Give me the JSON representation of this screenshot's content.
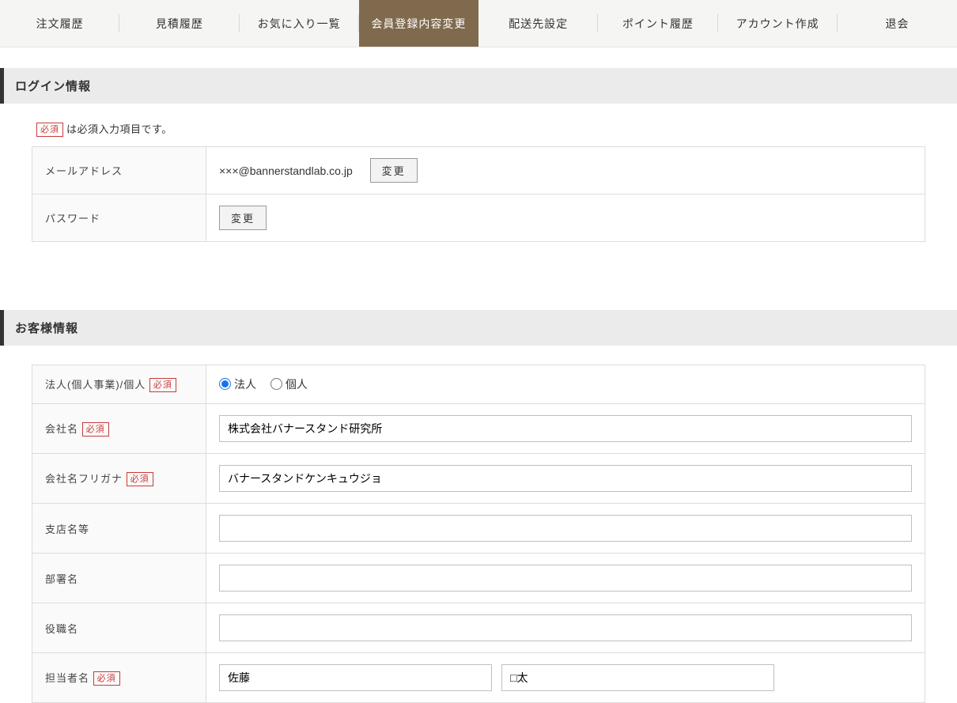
{
  "tabs": [
    {
      "label": "注文履歴",
      "active": false
    },
    {
      "label": "見積履歴",
      "active": false
    },
    {
      "label": "お気に入り一覧",
      "active": false
    },
    {
      "label": "会員登録内容変更",
      "active": true
    },
    {
      "label": "配送先設定",
      "active": false
    },
    {
      "label": "ポイント履歴",
      "active": false
    },
    {
      "label": "アカウント作成",
      "active": false
    },
    {
      "label": "退会",
      "active": false
    }
  ],
  "required_badge": "必須",
  "required_note_suffix": "は必須入力項目です。",
  "section_login_title": "ログイン情報",
  "section_customer_title": "お客様情報",
  "login": {
    "email_label": "メールアドレス",
    "email_value": "×××@bannerstandlab.co.jp",
    "password_label": "パスワード",
    "change_button": "変更"
  },
  "customer": {
    "entity_label": "法人(個人事業)/個人",
    "entity_corporate": "法人",
    "entity_individual": "個人",
    "entity_selected": "corporate",
    "company_label": "会社名",
    "company_value": "株式会社バナースタンド研究所",
    "company_kana_label": "会社名フリガナ",
    "company_kana_value": "バナースタンドケンキュウジョ",
    "branch_label": "支店名等",
    "branch_value": "",
    "department_label": "部署名",
    "department_value": "",
    "position_label": "役職名",
    "position_value": "",
    "contact_label": "担当者名",
    "contact_last": "佐藤",
    "contact_first": "□太"
  }
}
